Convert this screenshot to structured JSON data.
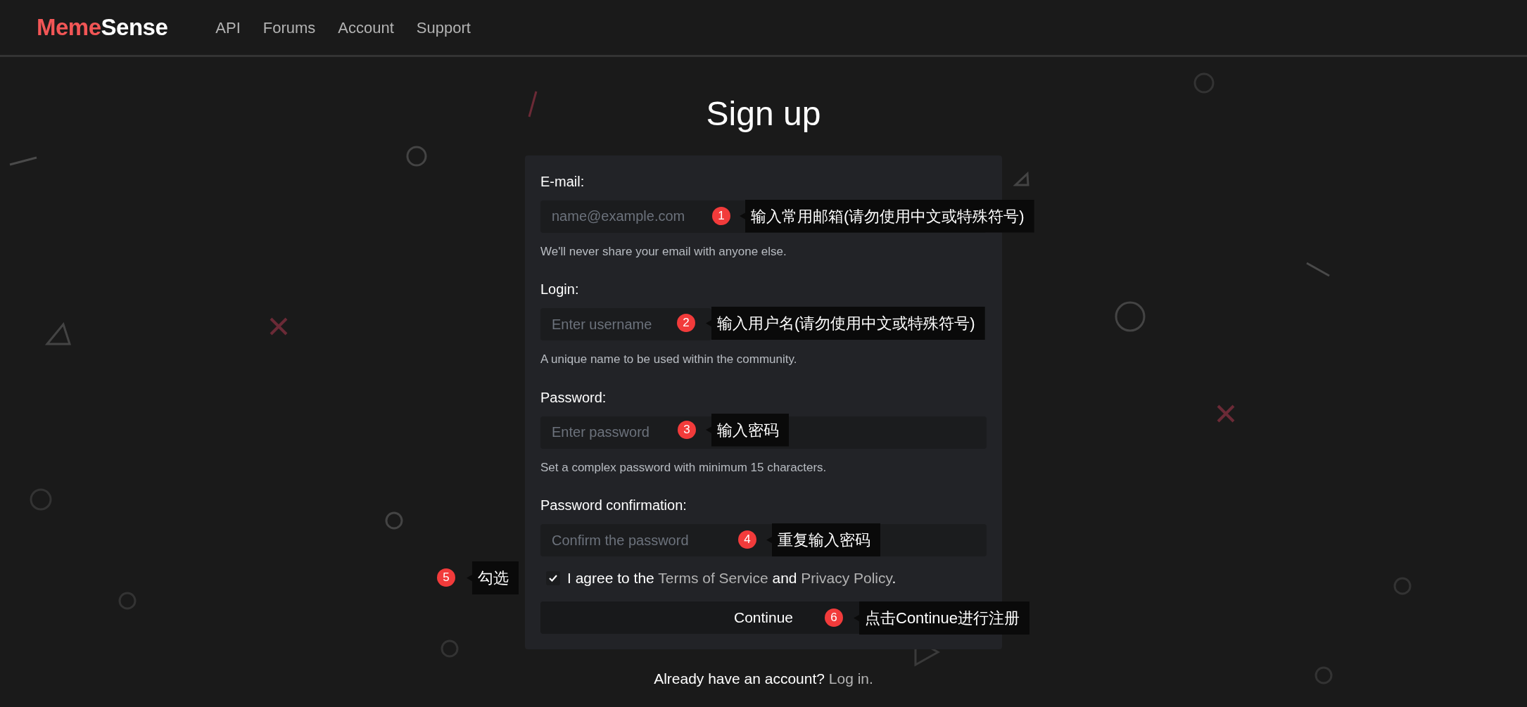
{
  "navbar": {
    "logo_prefix": "Meme",
    "logo_suffix": "Sense",
    "links": [
      "API",
      "Forums",
      "Account",
      "Support"
    ]
  },
  "title": "Sign up",
  "fields": [
    {
      "label": "E-mail:",
      "placeholder": "name@example.com",
      "help": "We'll never share your email with anyone else.",
      "annotation": {
        "number": "1",
        "text": "输入常用邮箱(请勿使用中文或特殊符号)"
      }
    },
    {
      "label": "Login:",
      "placeholder": "Enter username",
      "help": "A unique name to be used within the community.",
      "annotation": {
        "number": "2",
        "text": "输入用户名(请勿使用中文或特殊符号)"
      }
    },
    {
      "label": "Password:",
      "placeholder": "Enter password",
      "help": "Set a complex password with minimum 15 characters.",
      "annotation": {
        "number": "3",
        "text": "输入密码"
      }
    },
    {
      "label": "Password confirmation:",
      "placeholder": "Confirm the password",
      "annotation": {
        "number": "4",
        "text": "重复输入密码"
      }
    }
  ],
  "agreement": {
    "checked": true,
    "parts": [
      {
        "kind": "text",
        "text": "I agree to the"
      },
      {
        "kind": "link",
        "text": "Terms of Service"
      },
      {
        "kind": "text",
        "text": "and"
      },
      {
        "kind": "link",
        "text": "Privacy Policy"
      },
      {
        "kind": "punct",
        "text": "."
      }
    ],
    "annotation": {
      "number": "5",
      "text": "勾选"
    }
  },
  "submit": {
    "label": "Continue",
    "annotation": {
      "number": "6",
      "text": "点击Continue进行注册"
    }
  },
  "footer": {
    "text": "Already have an account?",
    "link": "Log in."
  }
}
